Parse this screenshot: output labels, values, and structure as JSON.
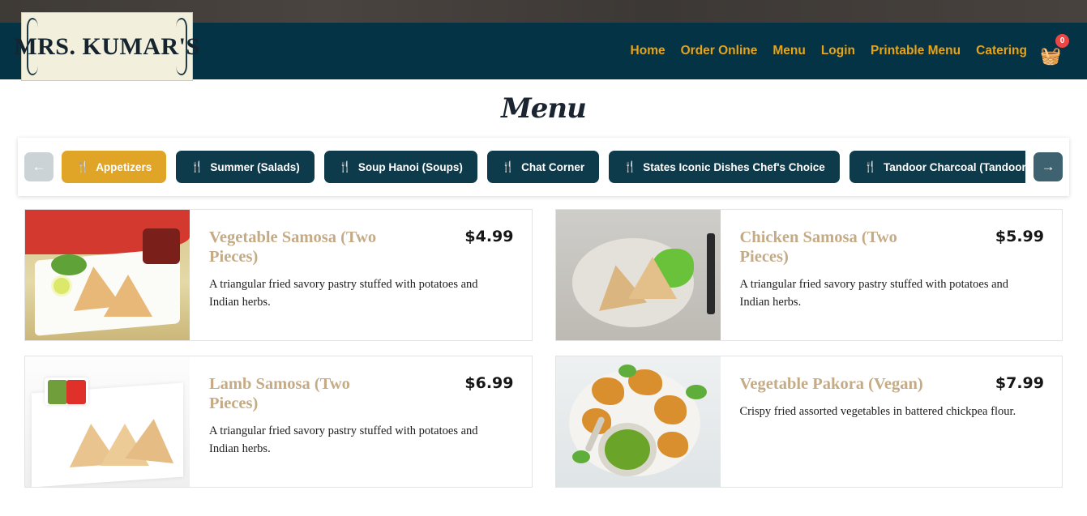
{
  "header": {
    "logo_text": "MRS. KUMAR'S",
    "nav_links": [
      {
        "label": "Home"
      },
      {
        "label": "Order Online"
      },
      {
        "label": "Menu"
      },
      {
        "label": "Login"
      },
      {
        "label": "Printable Menu"
      },
      {
        "label": "Catering"
      }
    ],
    "cart": {
      "icon": "shopping-basket-icon",
      "glyph": "🧺",
      "count": "0",
      "badge_color": "#ef4444",
      "icon_color": "#e8a317"
    },
    "nav_link_color": "#e8a317",
    "navbar_color": "#033345"
  },
  "page": {
    "title": "Menu"
  },
  "category_bar": {
    "prev_button": {
      "icon": "arrow-left-icon",
      "glyph": "←",
      "enabled": false
    },
    "next_button": {
      "icon": "arrow-right-icon",
      "glyph": "→",
      "enabled": true
    },
    "active_color": "#e0a526",
    "inactive_color": "#0e3b4c",
    "tabs": [
      {
        "label": "Appetizers",
        "icon": "cutlery-icon",
        "glyph": "🍴",
        "active": true
      },
      {
        "label": "Summer (Salads)",
        "icon": "cutlery-icon",
        "glyph": "🍴",
        "active": false
      },
      {
        "label": "Soup Hanoi (Soups)",
        "icon": "cutlery-icon",
        "glyph": "🍴",
        "active": false
      },
      {
        "label": "Chat Corner",
        "icon": "cutlery-icon",
        "glyph": "🍴",
        "active": false
      },
      {
        "label": "States Iconic Dishes Chef's Choice",
        "icon": "cutlery-icon",
        "glyph": "🍴",
        "active": false
      },
      {
        "label": "Tandoor Charcoal (Tandoori Entrees) - Non Veg",
        "icon": "cutlery-icon",
        "glyph": "🍴",
        "active": false
      }
    ]
  },
  "menu_items": [
    {
      "name": "Vegetable Samosa (Two Pieces)",
      "price": "$4.99",
      "description": "A triangular fried savory pastry stuffed with potatoes and Indian herbs.",
      "photo": "vegetable-samosa-photo"
    },
    {
      "name": "Chicken Samosa (Two Pieces)",
      "price": "$5.99",
      "description": "A triangular fried savory pastry stuffed with potatoes and Indian herbs.",
      "photo": "chicken-samosa-photo"
    },
    {
      "name": "Lamb Samosa (Two Pieces)",
      "price": "$6.99",
      "description": "A triangular fried savory pastry stuffed with potatoes and Indian herbs.",
      "photo": "lamb-samosa-photo"
    },
    {
      "name": "Vegetable Pakora (Vegan)",
      "price": "$7.99",
      "description": "Crispy fried assorted vegetables in battered chickpea flour.",
      "photo": "vegetable-pakora-photo"
    }
  ]
}
